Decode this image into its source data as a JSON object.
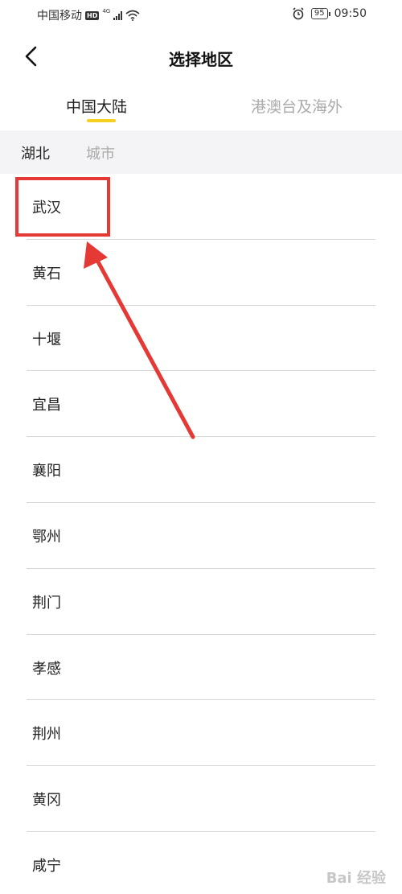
{
  "status_bar": {
    "carrier": "中国移动",
    "hd_badge": "HD",
    "network": "4G",
    "battery": "95",
    "time": "09:50",
    "icons": [
      "signal-icon",
      "wifi-icon",
      "alarm-icon",
      "battery-icon"
    ]
  },
  "header": {
    "title": "选择地区",
    "back_icon": "chevron-left-icon"
  },
  "tabs": [
    {
      "label": "中国大陆",
      "active": true
    },
    {
      "label": "港澳台及海外",
      "active": false
    }
  ],
  "breadcrumb": {
    "province": "湖北",
    "city_placeholder": "城市"
  },
  "cities": [
    "武汉",
    "黄石",
    "十堰",
    "宜昌",
    "襄阳",
    "鄂州",
    "荆门",
    "孝感",
    "荆州",
    "黄冈",
    "咸宁"
  ],
  "annotation": {
    "highlighted_city": "武汉",
    "color": "#e53935"
  },
  "colors": {
    "accent": "#f5d020",
    "inactive_text": "#aaaaaa",
    "breadcrumb_bg": "#f4f4f6"
  },
  "watermark": "Bai 经验"
}
